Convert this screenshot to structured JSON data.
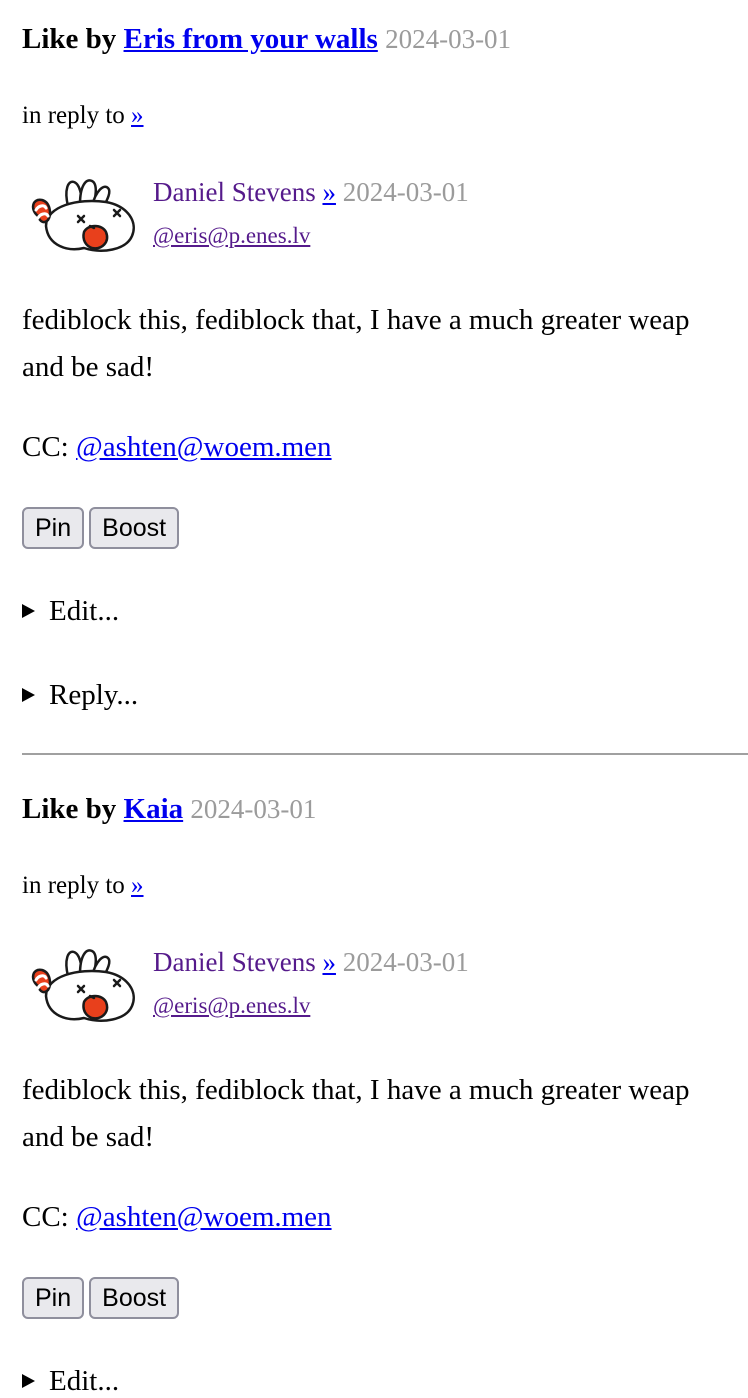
{
  "posts": [
    {
      "like_prefix": "Like by",
      "liker": "Eris from your walls",
      "like_date": "2024-03-01",
      "in_reply_prefix": "in reply to",
      "in_reply_link": "»",
      "author_name": "Daniel Stevens",
      "author_link": "»",
      "author_date": "2024-03-01",
      "author_handle": "@eris@p.enes.lv",
      "avatar_icon": "bunny-avatar-icon",
      "content_line1": "fediblock this, fediblock that, I have a much greater weap",
      "content_line2": "and be sad!",
      "cc_prefix": "CC:",
      "cc_link": "@ashten@woem.men",
      "pin_label": "Pin",
      "boost_label": "Boost",
      "edit_label": "Edit...",
      "reply_label": "Reply..."
    },
    {
      "like_prefix": "Like by",
      "liker": "Kaia",
      "like_date": "2024-03-01",
      "in_reply_prefix": "in reply to",
      "in_reply_link": "»",
      "author_name": "Daniel Stevens",
      "author_link": "»",
      "author_date": "2024-03-01",
      "author_handle": "@eris@p.enes.lv",
      "avatar_icon": "bunny-avatar-icon",
      "content_line1": "fediblock this, fediblock that, I have a much greater weap",
      "content_line2": "and be sad!",
      "cc_prefix": "CC:",
      "cc_link": "@ashten@woem.men",
      "pin_label": "Pin",
      "boost_label": "Boost",
      "edit_label": "Edit..."
    }
  ],
  "colors": {
    "link": "#0000ee",
    "visited": "#551a8b",
    "date": "#9b9b9b",
    "separator": "#a0a0a0",
    "avatar_accent": "#e8401c"
  }
}
